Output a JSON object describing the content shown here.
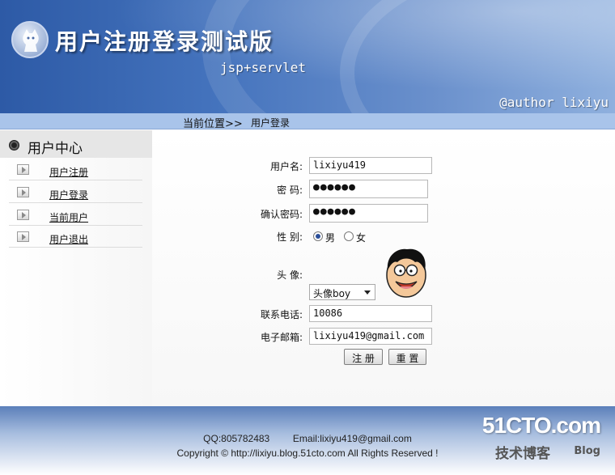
{
  "header": {
    "title": "用户注册登录测试版",
    "subtitle": "jsp+servlet",
    "author": "@author lixiyu"
  },
  "breadcrumb": {
    "label": "当前位置>>",
    "current": "用户登录"
  },
  "sidebar": {
    "title": "用户中心",
    "items": [
      {
        "label": "用户注册"
      },
      {
        "label": "用户登录"
      },
      {
        "label": "当前用户"
      },
      {
        "label": "用户退出"
      }
    ]
  },
  "form": {
    "username_label": "用户名:",
    "username_value": "lixiyu419",
    "password_label": "密 码:",
    "password_value": "●●●●●●",
    "confirm_label": "确认密码:",
    "confirm_value": "●●●●●●",
    "gender_label": "性 别:",
    "gender_options": [
      "男",
      "女"
    ],
    "gender_selected": "男",
    "avatar_label": "头 像:",
    "avatar_select_value": "头像boy",
    "phone_label": "联系电话:",
    "phone_value": "10086",
    "email_label": "电子邮箱:",
    "email_value": "lixiyu419@gmail.com",
    "register_button": "注 册",
    "reset_button": "重 置"
  },
  "footer": {
    "qq": "QQ:805782483",
    "email": "Email:lixiyu419@gmail.com",
    "copyright": "Copyright © http://lixiyu.blog.51cto.com  All Rights Reserved !"
  },
  "watermark": {
    "brand": "51CTO.com",
    "tagline": "技术博客",
    "blog": "Blog"
  },
  "colors": {
    "banner": "#3b68b3",
    "breadcrumb_bar": "#a9c4ea",
    "radio_selected": "#2b4f99"
  }
}
